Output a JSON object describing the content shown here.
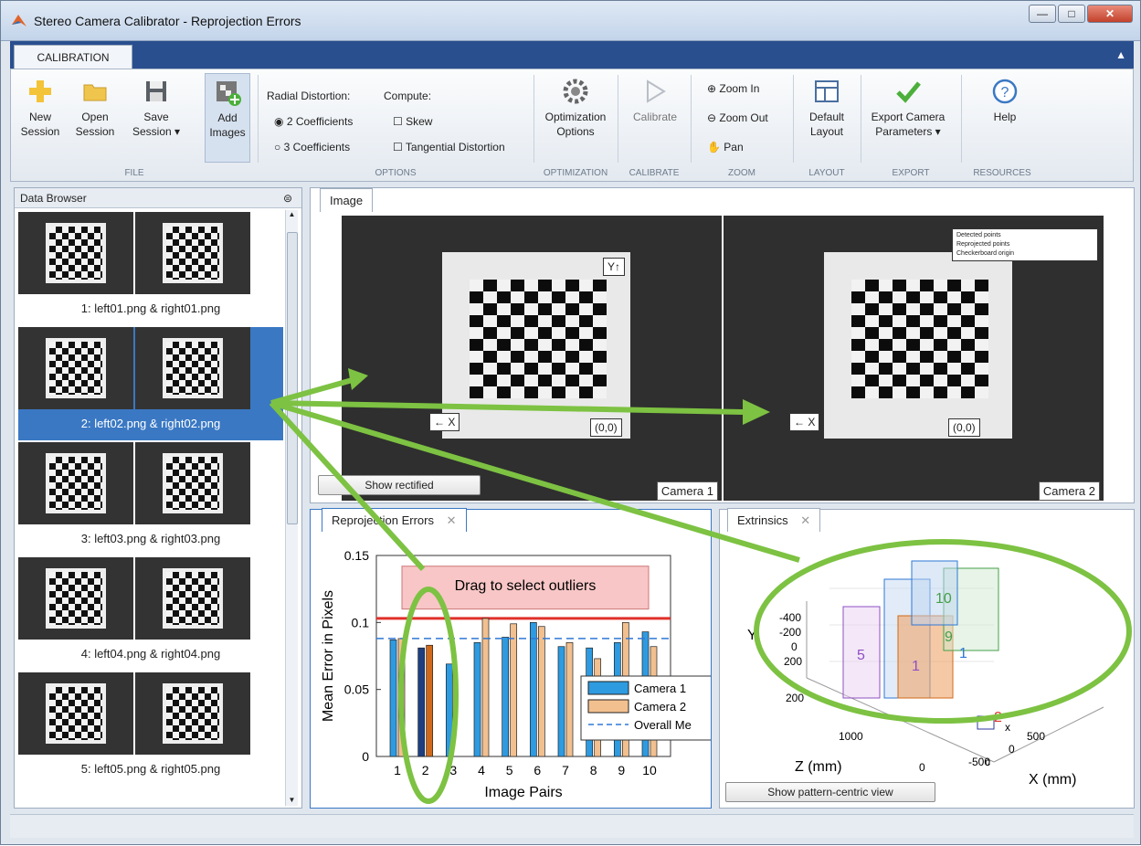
{
  "window": {
    "title": "Stereo Camera Calibrator - Reprojection Errors"
  },
  "ribbon": {
    "tab": "CALIBRATION",
    "new_session": [
      "New",
      "Session"
    ],
    "open_session": [
      "Open",
      "Session"
    ],
    "save_session": [
      "Save",
      "Session ▾"
    ],
    "add_images": [
      "Add",
      "Images"
    ],
    "file_group": "FILE",
    "radial_label": "Radial Distortion:",
    "compute_label": "Compute:",
    "coeff2": "2 Coefficients",
    "coeff3": "3 Coefficients",
    "skew": "Skew",
    "tangential": "Tangential Distortion",
    "options_group": "OPTIONS",
    "opt_options": [
      "Optimization",
      "Options"
    ],
    "optimization_group": "OPTIMIZATION",
    "calibrate": "Calibrate",
    "calibrate_group": "CALIBRATE",
    "zoom_in": "Zoom In",
    "zoom_out": "Zoom Out",
    "pan": "Pan",
    "zoom_group": "ZOOM",
    "default_layout": [
      "Default",
      "Layout"
    ],
    "layout_group": "LAYOUT",
    "export": [
      "Export Camera",
      "Parameters ▾"
    ],
    "export_group": "EXPORT",
    "help": "Help",
    "resources_group": "RESOURCES"
  },
  "browser": {
    "title": "Data Browser",
    "items": [
      "1: left01.png & right01.png",
      "2: left02.png & right02.png",
      "3: left03.png & right03.png",
      "4: left04.png & right04.png",
      "5: left05.png & right05.png"
    ],
    "selected_index": 1
  },
  "image_panel": {
    "tab": "Image",
    "camera1": "Camera 1",
    "camera2": "Camera 2",
    "show_rectified": "Show rectified",
    "origin_label": "(0,0)",
    "x_label": "← X",
    "y_label": "Y↑",
    "legend": [
      "Detected points",
      "Reprojected points",
      "Checkerboard origin"
    ]
  },
  "reproj": {
    "tab": "Reprojection Errors",
    "drag_text": "Drag to select outliers",
    "legend": [
      "Camera 1",
      "Camera 2",
      "Overall Me"
    ]
  },
  "chart_data": {
    "type": "bar",
    "title": "",
    "xlabel": "Image Pairs",
    "ylabel": "Mean Error in Pixels",
    "categories": [
      "1",
      "2",
      "3",
      "4",
      "5",
      "6",
      "7",
      "8",
      "9",
      "10"
    ],
    "ylim": [
      0,
      0.15
    ],
    "yticks": [
      0,
      0.05,
      0.1,
      0.15
    ],
    "series": [
      {
        "name": "Camera 1",
        "values": [
          0.087,
          0.081,
          0.069,
          0.085,
          0.089,
          0.1,
          0.082,
          0.081,
          0.085,
          0.093
        ],
        "color": "#2e9be0"
      },
      {
        "name": "Camera 2",
        "values": [
          0.088,
          0.083,
          0.0,
          0.103,
          0.099,
          0.097,
          0.085,
          0.073,
          0.1,
          0.082
        ],
        "color": "#f2c08f"
      }
    ],
    "overall_mean": 0.088,
    "threshold": 0.103,
    "colors": {
      "camera1": "#2e9be0",
      "camera2": "#f2c08f",
      "selected": "#d06a1a",
      "mean": "#2e78d6",
      "threshold": "#e0312a",
      "drag": "#f8c6c6"
    }
  },
  "extrinsics": {
    "tab": "Extrinsics",
    "show_pattern": "Show pattern-centric view",
    "z_label": "Z (mm)",
    "x_label": "X (mm)",
    "y_label": "Y",
    "yticks": [
      "-400",
      "-200",
      "0",
      "200"
    ],
    "zticks": [
      "1000",
      "0",
      "200"
    ],
    "xticks": [
      "500",
      "0",
      "-500"
    ],
    "plane_labels": [
      "10",
      "9",
      "1",
      "5",
      "1",
      "2"
    ]
  },
  "annotation": {
    "accent": "#7dc242"
  }
}
